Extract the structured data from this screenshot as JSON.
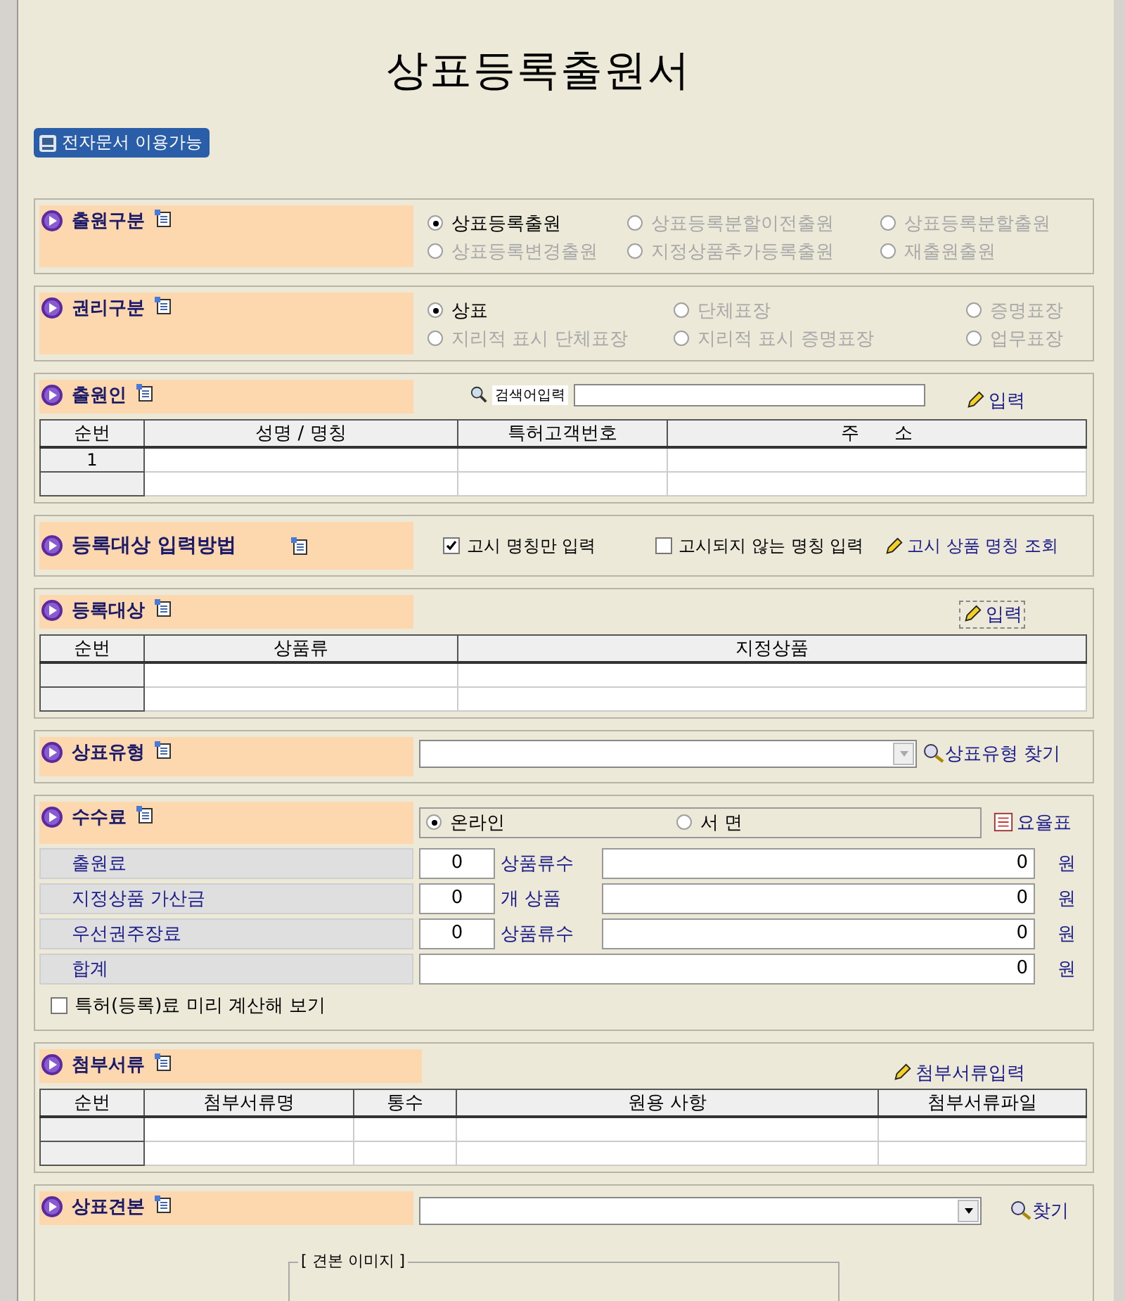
{
  "title": "상표등록출원서",
  "e_doc_badge": "전자문서 이용가능",
  "application_type": {
    "label": "출원구분",
    "options": [
      {
        "label": "상표등록출원",
        "selected": true,
        "disabled": false
      },
      {
        "label": "상표등록분할이전출원",
        "selected": false,
        "disabled": true
      },
      {
        "label": "상표등록분할출원",
        "selected": false,
        "disabled": true
      },
      {
        "label": "상표등록변경출원",
        "selected": false,
        "disabled": true
      },
      {
        "label": "지정상품추가등록출원",
        "selected": false,
        "disabled": true
      },
      {
        "label": "재출원출원",
        "selected": false,
        "disabled": true
      }
    ]
  },
  "right_type": {
    "label": "권리구분",
    "options": [
      {
        "label": "상표",
        "selected": true,
        "disabled": false
      },
      {
        "label": "단체표장",
        "selected": false,
        "disabled": true
      },
      {
        "label": "증명표장",
        "selected": false,
        "disabled": true
      },
      {
        "label": "지리적 표시 단체표장",
        "selected": false,
        "disabled": true
      },
      {
        "label": "지리적 표시 증명표장",
        "selected": false,
        "disabled": true
      },
      {
        "label": "업무표장",
        "selected": false,
        "disabled": true
      }
    ]
  },
  "applicant": {
    "label": "출원인",
    "search_label": "검색어입력",
    "input_link": "입력",
    "columns": [
      "순번",
      "성명 / 명칭",
      "특허고객번호",
      "주      소"
    ],
    "row_numbers": [
      "1"
    ]
  },
  "input_method": {
    "label": "등록대상 입력방법",
    "options": [
      {
        "label": "고시 명칭만 입력",
        "checked": true
      },
      {
        "label": "고시되지 않는 명칭 입력",
        "checked": false
      }
    ],
    "lookup_link": "고시 상품 명칭 조회"
  },
  "registration_target": {
    "label": "등록대상",
    "input_link": "입력",
    "columns": [
      "순번",
      "상품류",
      "지정상품"
    ]
  },
  "trademark_type": {
    "label": "상표유형",
    "find_link": "상표유형 찾기"
  },
  "fees": {
    "label": "수수료",
    "modes": [
      {
        "label": "온라인",
        "selected": true
      },
      {
        "label": "서  면",
        "selected": false
      }
    ],
    "rate_table_link": "요율표",
    "rows": [
      {
        "label": "출원료",
        "count": "0",
        "unit": "상품류수",
        "amount": "0",
        "currency": "원"
      },
      {
        "label": "지정상품 가산금",
        "count": "0",
        "unit": "개 상품",
        "amount": "0",
        "currency": "원"
      },
      {
        "label": "우선권주장료",
        "count": "0",
        "unit": "상품류수",
        "amount": "0",
        "currency": "원"
      }
    ],
    "total": {
      "label": "합계",
      "amount": "0",
      "currency": "원"
    },
    "precalc": {
      "label": "특허(등록)료 미리 계산해 보기",
      "checked": false
    }
  },
  "attachments": {
    "label": "첨부서류",
    "input_link": "첨부서류입력",
    "columns": [
      "순번",
      "첨부서류명",
      "통수",
      "원용 사항",
      "첨부서류파일"
    ]
  },
  "specimen": {
    "label": "상표견본",
    "find_link": "찾기",
    "image_frame_label": "[ 견본 이미지 ]"
  }
}
